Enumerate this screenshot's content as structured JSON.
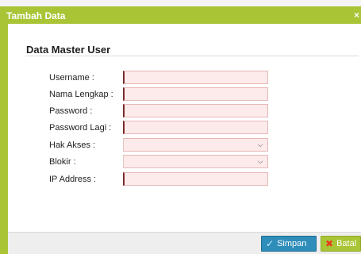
{
  "dialog": {
    "title": "Tambah Data",
    "close_label": "×"
  },
  "form": {
    "section_title": "Data Master User",
    "fields": [
      {
        "label": "Username :",
        "type": "text",
        "value": ""
      },
      {
        "label": "Nama Lengkap :",
        "type": "text",
        "value": ""
      },
      {
        "label": "Password :",
        "type": "password",
        "value": ""
      },
      {
        "label": "Password Lagi :",
        "type": "password",
        "value": ""
      },
      {
        "label": "Hak Akses :",
        "type": "select",
        "value": ""
      },
      {
        "label": "Blokir :",
        "type": "select",
        "value": ""
      },
      {
        "label": "IP Address :",
        "type": "text",
        "value": ""
      }
    ]
  },
  "footer": {
    "save_label": "Simpan",
    "cancel_label": "Batal"
  },
  "colors": {
    "titlebar": "#a9c536",
    "save_button": "#2e8db9",
    "required_field_bg": "#fdeaea"
  },
  "icons": {
    "save": "check-icon",
    "cancel": "x-icon",
    "select": "chevron-down-icon"
  }
}
